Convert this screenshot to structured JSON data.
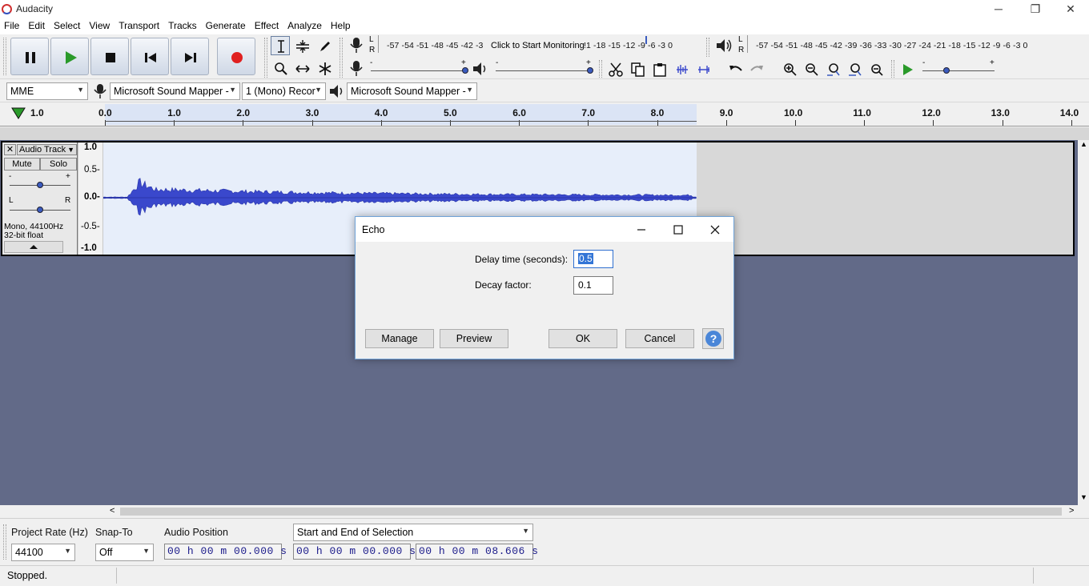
{
  "window": {
    "title": "Audacity",
    "controls": [
      "─",
      "❐",
      "✕"
    ]
  },
  "menus": [
    "File",
    "Edit",
    "Select",
    "View",
    "Transport",
    "Tracks",
    "Generate",
    "Effect",
    "Analyze",
    "Help"
  ],
  "meters": {
    "record_scale": "-57 -54 -51 -48 -45 -42 -3",
    "record_prompt": "Click to Start Monitoring",
    "record_scale_tail": "!1 -18 -15 -12 -9 -6 -3 0",
    "play_scale": "-57 -54 -51 -48 -45 -42 -39 -36 -33 -30 -27 -24 -21 -18 -15 -12 -9 -6 -3 0",
    "lr_l": "L",
    "lr_r": "R",
    "slider_minus": "-",
    "slider_plus": "+"
  },
  "device": {
    "host": "MME",
    "recording_device": "Microsoft Sound Mapper -",
    "channels": "1 (Mono) Recor",
    "playback_device": "Microsoft Sound Mapper -"
  },
  "ruler": {
    "start_label": "1.0",
    "ticks": [
      "0.0",
      "1.0",
      "2.0",
      "3.0",
      "4.0",
      "5.0",
      "6.0",
      "7.0",
      "8.0",
      "9.0",
      "10.0",
      "11.0",
      "12.0",
      "13.0",
      "14.0"
    ]
  },
  "track": {
    "name": "Audio Track",
    "close": "✕",
    "mute": "Mute",
    "solo": "Solo",
    "gain_minus": "-",
    "gain_plus": "+",
    "pan_l": "L",
    "pan_r": "R",
    "info_line1": "Mono, 44100Hz",
    "info_line2": "32-bit float",
    "scale": [
      "1.0",
      "0.5-",
      "0.0-",
      "-0.5-",
      "-1.0"
    ]
  },
  "selection_toolbar": {
    "project_rate_label": "Project Rate (Hz)",
    "project_rate_value": "44100",
    "snap_to_label": "Snap-To",
    "snap_to_value": "Off",
    "audio_position_label": "Audio Position",
    "selection_mode": "Start and End of Selection",
    "audio_position_time": "00 h 00 m 00.000 s",
    "selection_start_time": "00 h 00 m 00.000 s",
    "selection_end_time": "00 h 00 m 08.606 s"
  },
  "status": {
    "text": "Stopped."
  },
  "dialog": {
    "title": "Echo",
    "delay_label": "Delay time (seconds):",
    "delay_value": "0.5",
    "decay_label": "Decay factor:",
    "decay_value": "0.1",
    "manage": "Manage",
    "preview": "Preview",
    "ok": "OK",
    "cancel": "Cancel",
    "help": "?"
  },
  "colors": {
    "waveform": "#3a48cc",
    "track_bg": "#626a88",
    "selection": "#e7eefa",
    "record_red": "#e02020",
    "play_green": "#2a9a2a"
  }
}
